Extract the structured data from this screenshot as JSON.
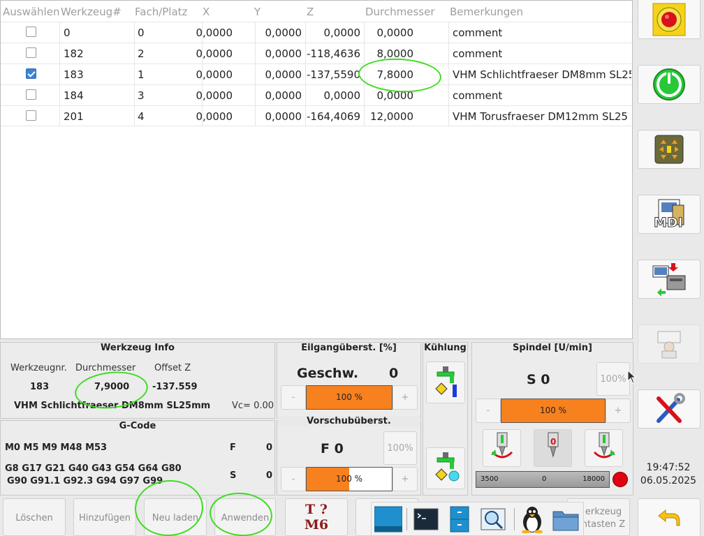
{
  "tool_table": {
    "columns": [
      "Auswählen",
      "Werkzeug#",
      "Fach/Platz",
      "X",
      "Y",
      "Z",
      "Durchmesser",
      "Bemerkungen"
    ],
    "rows": [
      {
        "checked": false,
        "tool": "0",
        "slot": "0",
        "x": "0,0000",
        "y": "0,0000",
        "z": "0,0000",
        "diameter": "0,0000",
        "comment": "comment"
      },
      {
        "checked": false,
        "tool": "182",
        "slot": "2",
        "x": "0,0000",
        "y": "0,0000",
        "z": "-118,4636",
        "diameter": "8,0000",
        "comment": "comment"
      },
      {
        "checked": true,
        "tool": "183",
        "slot": "1",
        "x": "0,0000",
        "y": "0,0000",
        "z": "-137,5590",
        "diameter": "7,8000",
        "comment": "VHM Schlichtfraeser DM8mm SL25"
      },
      {
        "checked": false,
        "tool": "184",
        "slot": "3",
        "x": "0,0000",
        "y": "0,0000",
        "z": "0,0000",
        "diameter": "0,0000",
        "comment": "comment"
      },
      {
        "checked": false,
        "tool": "201",
        "slot": "4",
        "x": "0,0000",
        "y": "0,0000",
        "z": "-164,4069",
        "diameter": "12,0000",
        "comment": "VHM Torusfraeser DM12mm SL25"
      }
    ]
  },
  "tool_info": {
    "title": "Werkzeug Info",
    "label_number": "Werkzeugnr.",
    "label_diameter": "Durchmesser",
    "label_offset": "Offset Z",
    "number": "183",
    "diameter": "7,9000",
    "offset": "-137.559",
    "description": "VHM Schlichtfraeser DM8mm SL25mm",
    "vc": "Vc= 0.00"
  },
  "gcode": {
    "title": "G-Code",
    "line1": "M0 M5 M9 M48 M53",
    "line2": "G8 G17 G21 G40 G43 G54 G64 G80",
    "line3": "G90 G91.1 G92.3 G94 G97 G99",
    "f_label": "F",
    "f_value": "0",
    "s_label": "S",
    "s_value": "0"
  },
  "rapid": {
    "title": "Eilgangüberst. [%]",
    "speed_label": "Geschw.",
    "speed_value": "0",
    "minus": "-",
    "plus": "+",
    "bar_text": "100 %",
    "bar_fill": 1.0
  },
  "feed": {
    "title": "Vorschubüberst.",
    "value": "F  0",
    "reset": "100%",
    "minus": "-",
    "plus": "+",
    "bar_text": "100 %",
    "bar_fill": 0.5
  },
  "cooling": {
    "title": "Kühlung"
  },
  "spindle": {
    "title": "Spindel [U/min]",
    "value": "S 0",
    "reset": "100%",
    "minus": "-",
    "plus": "+",
    "bar_text": "100 %",
    "bar_fill": 1.0,
    "scale_min": "3500",
    "scale_mid": "0",
    "scale_max": "18000",
    "stop_label": "0"
  },
  "bottom_buttons": {
    "delete": "Löschen",
    "add": "Hinzufügen",
    "reload": "Neu laden",
    "apply": "Anwenden",
    "tool_change_t": "T ?",
    "tool_change_m": "M6",
    "probe_line1": "erkzeug",
    "probe_line2": "ntasten Z"
  },
  "clock": {
    "time": "19:47:52",
    "date": "06.05.2025"
  },
  "sidebar": {
    "mdi_label": "MDI",
    "estop_text": "Emergency Stop"
  },
  "colors": {
    "accent_orange": "#f7811e",
    "annotation_green": "#3ddc20",
    "checkbox_blue": "#3a84d6"
  }
}
